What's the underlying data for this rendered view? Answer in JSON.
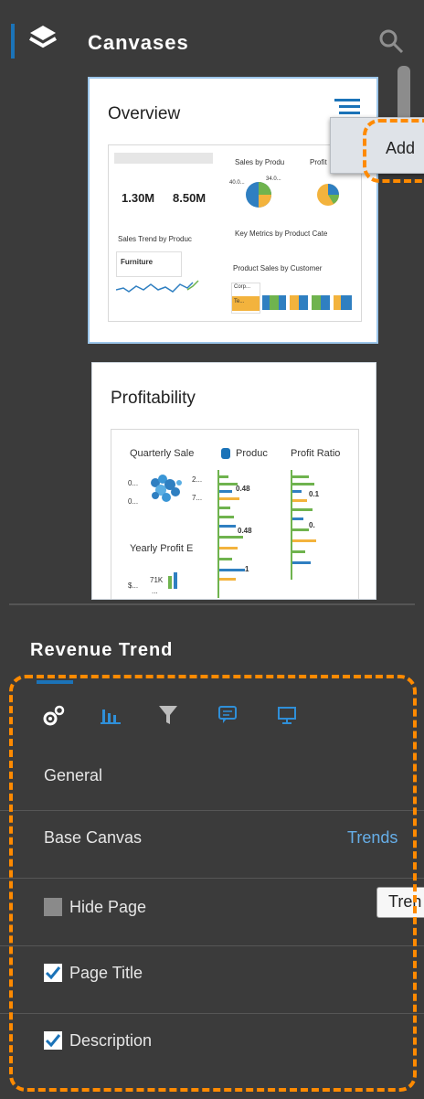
{
  "panel": {
    "title": "Canvases",
    "icons": {
      "layers": "layers-icon",
      "search": "search-icon",
      "menu": "hamburger-menu-icon"
    }
  },
  "canvases": [
    {
      "title": "Overview",
      "thumb": {
        "kpi1": "1.30M",
        "kpi2": "8.50M",
        "chart1": "Sales by Produ",
        "chart2": "Profit",
        "pie_label1": "40.0...",
        "pie_label2": "34.0...",
        "metrics": "Key Metrics by Product Cate",
        "trend": "Sales Trend by Produc",
        "furniture": "Furniture",
        "customer": "Product Sales by Customer",
        "corp": "Corp...",
        "te": "Te..."
      }
    },
    {
      "title": "Profitability",
      "thumb": {
        "quarterly": "Quarterly Sale",
        "product": "Produc",
        "ratio": "Profit Ratio",
        "v1": "0...",
        "v2": "0...",
        "v3": "2...",
        "v4": "7...",
        "v5": "0.48",
        "v6": "0.1",
        "v7": "0.48",
        "v8": "0.",
        "v9": "1",
        "yearly": "Yearly Profit E",
        "y1": "$...",
        "y2": "71K",
        "y3": "..."
      }
    }
  ],
  "add_menu": {
    "label": "Add"
  },
  "properties": {
    "title": "Revenue Trend",
    "tabs": [
      "gear-icon",
      "bar-chart-icon",
      "filter-icon",
      "comment-icon",
      "presentation-icon"
    ],
    "general": "General",
    "base_canvas_label": "Base Canvas",
    "base_canvas_value": "Trends",
    "hide_page": "Hide Page",
    "hide_page_checked": false,
    "tooltip": "Tren",
    "page_title": "Page Title",
    "page_title_checked": true,
    "description": "Description",
    "description_checked": true
  },
  "colors": {
    "accent": "#1b73b8",
    "highlight": "#ff8a00",
    "panel_bg": "#3b3b3b",
    "link": "#66aee8"
  }
}
